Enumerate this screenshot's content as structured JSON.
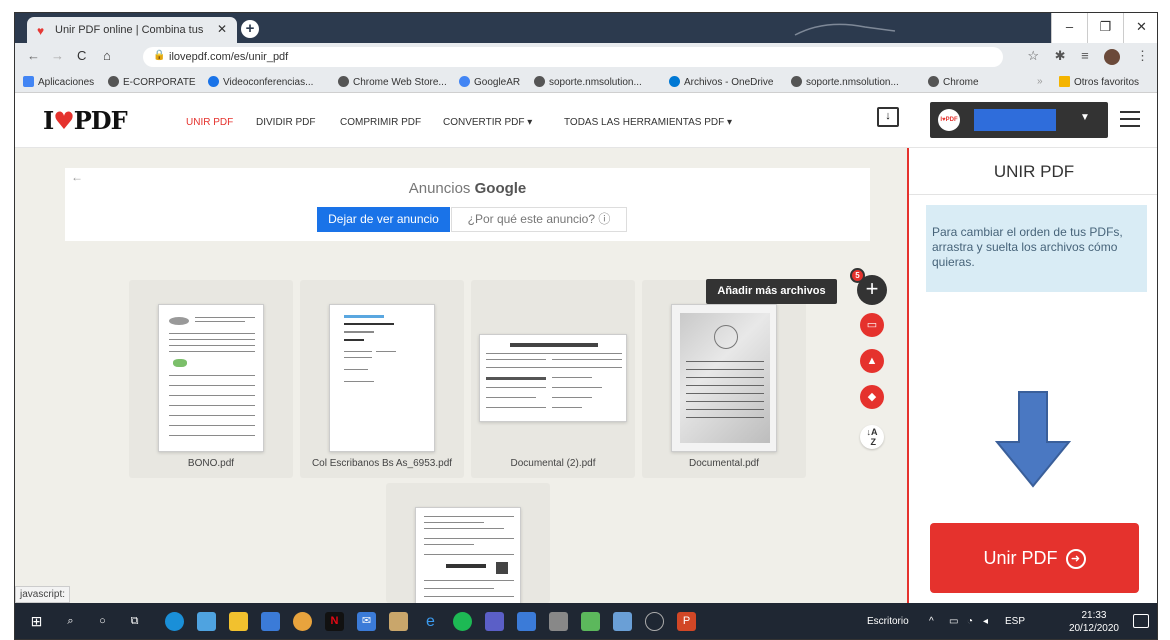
{
  "browser": {
    "tab_title": "Unir PDF online | Combina tus ar",
    "url": "ilovepdf.com/es/unir_pdf",
    "bookmarks": [
      {
        "label": "Aplicaciones",
        "color": "#4285f4"
      },
      {
        "label": "E-CORPORATE",
        "color": "#555555"
      },
      {
        "label": "Videoconferencias...",
        "color": "#1a73e8"
      },
      {
        "label": "Chrome Web Store...",
        "color": "#4285f4"
      },
      {
        "label": "GoogleAR",
        "color": "#4285f4"
      },
      {
        "label": "soporte.nmsolution...",
        "color": "#555555"
      },
      {
        "label": "Archivos - OneDrive",
        "color": "#0078d4"
      },
      {
        "label": "soporte.nmsolution...",
        "color": "#555555"
      },
      {
        "label": "Chrome",
        "color": "#555555"
      }
    ],
    "bookmarks_overflow": "»",
    "other_favorites": "Otros favoritos"
  },
  "site": {
    "logo_prefix": "I",
    "logo_suffix": "PDF",
    "nav": {
      "merge": "UNIR PDF",
      "split": "DIVIDIR PDF",
      "compress": "COMPRIMIR PDF",
      "convert": "CONVERTIR PDF ▾",
      "all_tools": "TODAS LAS HERRAMIENTAS PDF ▾"
    },
    "avatar_text": "I♥PDF"
  },
  "ad": {
    "title_prefix": "Anuncios",
    "title_brand": "Google",
    "stop_label": "Dejar de ver anuncio",
    "why_label": "¿Por qué este anuncio? ⓘ"
  },
  "files": [
    {
      "name": "BONO.pdf"
    },
    {
      "name": "Col Escribanos Bs As_6953.pdf"
    },
    {
      "name": "Documental (2).pdf"
    },
    {
      "name": "Documental.pdf"
    },
    {
      "name": ""
    }
  ],
  "tools": {
    "add_more_label": "Añadir más archivos",
    "file_count": "5",
    "sort_icon": "sort-az-icon"
  },
  "status_bar": "javascript:",
  "panel": {
    "title": "UNIR PDF",
    "info": "Para cambiar el orden de tus PDFs, arrastra y suelta los archivos cómo quieras.",
    "merge_button": "Unir PDF",
    "accent": "#e5322d"
  },
  "taskbar": {
    "desktop_label": "Escritorio",
    "language": "ESP",
    "time": "21:33",
    "date": "20/12/2020"
  }
}
